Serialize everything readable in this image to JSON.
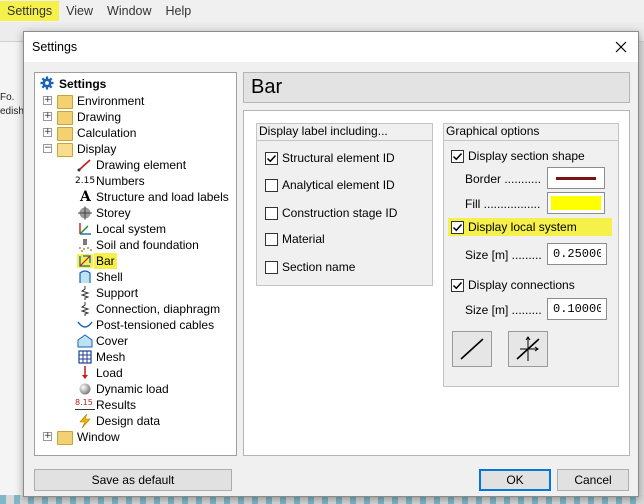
{
  "menubar": {
    "items": [
      {
        "label": "Settings"
      },
      {
        "label": "View"
      },
      {
        "label": "Window"
      },
      {
        "label": "Help"
      }
    ]
  },
  "background": {
    "left_fragments": [
      "Fo.",
      "edish"
    ]
  },
  "dialog": {
    "title": "Settings",
    "tree": [
      {
        "label": "Settings",
        "icon": "gear-icon",
        "level": 0
      },
      {
        "label": "Environment",
        "icon": "folder-icon",
        "level": 1,
        "expander": "+"
      },
      {
        "label": "Drawing",
        "icon": "folder-icon",
        "level": 1,
        "expander": "+"
      },
      {
        "label": "Calculation",
        "icon": "folder-icon",
        "level": 1,
        "expander": "+"
      },
      {
        "label": "Display",
        "icon": "folder-open-icon",
        "level": 1,
        "expander": "−"
      },
      {
        "label": "Drawing element",
        "icon": "drawing-element-icon",
        "level": 2
      },
      {
        "label": "Numbers",
        "icon": "numbers-icon",
        "level": 2,
        "icon_text": "2.15"
      },
      {
        "label": "Structure and load labels",
        "icon": "letter-a-icon",
        "level": 2,
        "icon_text": "A"
      },
      {
        "label": "Storey",
        "icon": "storey-icon",
        "level": 2
      },
      {
        "label": "Local system",
        "icon": "local-system-icon",
        "level": 2
      },
      {
        "label": "Soil and foundation",
        "icon": "soil-icon",
        "level": 2
      },
      {
        "label": "Bar",
        "icon": "bar-icon",
        "level": 2,
        "selected": true
      },
      {
        "label": "Shell",
        "icon": "shell-icon",
        "level": 2
      },
      {
        "label": "Support",
        "icon": "support-icon",
        "level": 2
      },
      {
        "label": "Connection, diaphragm",
        "icon": "connection-icon",
        "level": 2
      },
      {
        "label": "Post-tensioned cables",
        "icon": "cable-icon",
        "level": 2
      },
      {
        "label": "Cover",
        "icon": "cover-icon",
        "level": 2
      },
      {
        "label": "Mesh",
        "icon": "mesh-icon",
        "level": 2
      },
      {
        "label": "Load",
        "icon": "load-icon",
        "level": 2
      },
      {
        "label": "Dynamic load",
        "icon": "dynamic-load-icon",
        "level": 2
      },
      {
        "label": "Results",
        "icon": "results-icon",
        "level": 2,
        "icon_text": "8.15"
      },
      {
        "label": "Design data",
        "icon": "lightning-icon",
        "level": 2
      },
      {
        "label": "Window",
        "icon": "folder-icon",
        "level": 1,
        "expander": "+"
      }
    ],
    "panel_heading": "Bar",
    "display_label_group": {
      "title": "Display label including...",
      "options": [
        {
          "label": "Structural element ID",
          "checked": true
        },
        {
          "label": "Analytical element ID",
          "checked": false
        },
        {
          "label": "Construction stage ID",
          "checked": false
        },
        {
          "label": "Material",
          "checked": false
        },
        {
          "label": "Section name",
          "checked": false
        }
      ]
    },
    "graphical_group": {
      "title": "Graphical options",
      "display_section_shape": {
        "label": "Display section shape",
        "checked": true
      },
      "border_label": "Border ...........",
      "border_color": "#7a1414",
      "fill_label": "Fill .................",
      "fill_color": "#ffff00",
      "display_local_system": {
        "label": "Display local system",
        "checked": true
      },
      "local_size_label": "Size [m] .........",
      "local_size_value": "0.25000",
      "display_connections": {
        "label": "Display connections",
        "checked": true
      },
      "conn_size_label": "Size [m] .........",
      "conn_size_value": "0.10000",
      "line_button_icon": "line-icon",
      "connection_button_icon": "connection-symbol-icon"
    },
    "buttons": {
      "save_default": "Save as default",
      "ok": "OK",
      "cancel": "Cancel"
    },
    "highlight_color": "#f5f04a"
  }
}
